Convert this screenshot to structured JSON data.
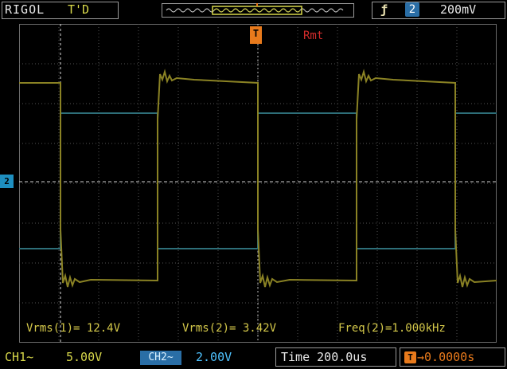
{
  "header": {
    "brand": "RIGOL",
    "trigger_state": "T'D",
    "trigger_edge_icon": "rising-edge-icon",
    "trigger_source": "2",
    "trigger_level": "200mV"
  },
  "markers": {
    "trigger_position_label": "T",
    "channel_marker_label": "2",
    "remote_label": "Rmt"
  },
  "measurements": {
    "vrms1": "Vrms(1)= 12.4V",
    "vrms2": "Vrms(2)= 3.42V",
    "freq2": "Freq(2)=1.000kHz"
  },
  "footer": {
    "ch1_label": "CH1~",
    "ch1_scale": "5.00V",
    "ch2_label": "CH2~",
    "ch2_scale": "2.00V",
    "timebase": "Time 200.0us",
    "trigger_delay_icon": "T",
    "trigger_delay": "0.0000s"
  },
  "colors": {
    "ch1": "#8a8224",
    "ch2": "#2e6f79",
    "grid": "#5a5a5a",
    "accent": "#e87a1c",
    "remote": "#d22b2b"
  }
}
